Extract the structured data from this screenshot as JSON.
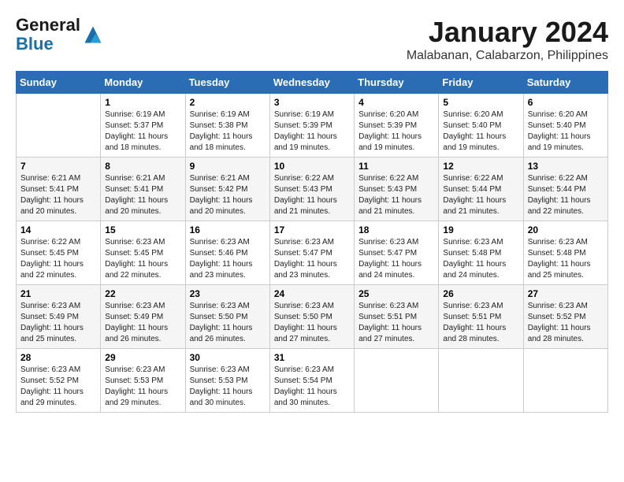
{
  "logo": {
    "general": "General",
    "blue": "Blue"
  },
  "title": "January 2024",
  "subtitle": "Malabanan, Calabarzon, Philippines",
  "days_header": [
    "Sunday",
    "Monday",
    "Tuesday",
    "Wednesday",
    "Thursday",
    "Friday",
    "Saturday"
  ],
  "weeks": [
    [
      {
        "day": "",
        "sunrise": "",
        "sunset": "",
        "daylight": ""
      },
      {
        "day": "1",
        "sunrise": "Sunrise: 6:19 AM",
        "sunset": "Sunset: 5:37 PM",
        "daylight": "Daylight: 11 hours and 18 minutes."
      },
      {
        "day": "2",
        "sunrise": "Sunrise: 6:19 AM",
        "sunset": "Sunset: 5:38 PM",
        "daylight": "Daylight: 11 hours and 18 minutes."
      },
      {
        "day": "3",
        "sunrise": "Sunrise: 6:19 AM",
        "sunset": "Sunset: 5:39 PM",
        "daylight": "Daylight: 11 hours and 19 minutes."
      },
      {
        "day": "4",
        "sunrise": "Sunrise: 6:20 AM",
        "sunset": "Sunset: 5:39 PM",
        "daylight": "Daylight: 11 hours and 19 minutes."
      },
      {
        "day": "5",
        "sunrise": "Sunrise: 6:20 AM",
        "sunset": "Sunset: 5:40 PM",
        "daylight": "Daylight: 11 hours and 19 minutes."
      },
      {
        "day": "6",
        "sunrise": "Sunrise: 6:20 AM",
        "sunset": "Sunset: 5:40 PM",
        "daylight": "Daylight: 11 hours and 19 minutes."
      }
    ],
    [
      {
        "day": "7",
        "sunrise": "Sunrise: 6:21 AM",
        "sunset": "Sunset: 5:41 PM",
        "daylight": "Daylight: 11 hours and 20 minutes."
      },
      {
        "day": "8",
        "sunrise": "Sunrise: 6:21 AM",
        "sunset": "Sunset: 5:41 PM",
        "daylight": "Daylight: 11 hours and 20 minutes."
      },
      {
        "day": "9",
        "sunrise": "Sunrise: 6:21 AM",
        "sunset": "Sunset: 5:42 PM",
        "daylight": "Daylight: 11 hours and 20 minutes."
      },
      {
        "day": "10",
        "sunrise": "Sunrise: 6:22 AM",
        "sunset": "Sunset: 5:43 PM",
        "daylight": "Daylight: 11 hours and 21 minutes."
      },
      {
        "day": "11",
        "sunrise": "Sunrise: 6:22 AM",
        "sunset": "Sunset: 5:43 PM",
        "daylight": "Daylight: 11 hours and 21 minutes."
      },
      {
        "day": "12",
        "sunrise": "Sunrise: 6:22 AM",
        "sunset": "Sunset: 5:44 PM",
        "daylight": "Daylight: 11 hours and 21 minutes."
      },
      {
        "day": "13",
        "sunrise": "Sunrise: 6:22 AM",
        "sunset": "Sunset: 5:44 PM",
        "daylight": "Daylight: 11 hours and 22 minutes."
      }
    ],
    [
      {
        "day": "14",
        "sunrise": "Sunrise: 6:22 AM",
        "sunset": "Sunset: 5:45 PM",
        "daylight": "Daylight: 11 hours and 22 minutes."
      },
      {
        "day": "15",
        "sunrise": "Sunrise: 6:23 AM",
        "sunset": "Sunset: 5:45 PM",
        "daylight": "Daylight: 11 hours and 22 minutes."
      },
      {
        "day": "16",
        "sunrise": "Sunrise: 6:23 AM",
        "sunset": "Sunset: 5:46 PM",
        "daylight": "Daylight: 11 hours and 23 minutes."
      },
      {
        "day": "17",
        "sunrise": "Sunrise: 6:23 AM",
        "sunset": "Sunset: 5:47 PM",
        "daylight": "Daylight: 11 hours and 23 minutes."
      },
      {
        "day": "18",
        "sunrise": "Sunrise: 6:23 AM",
        "sunset": "Sunset: 5:47 PM",
        "daylight": "Daylight: 11 hours and 24 minutes."
      },
      {
        "day": "19",
        "sunrise": "Sunrise: 6:23 AM",
        "sunset": "Sunset: 5:48 PM",
        "daylight": "Daylight: 11 hours and 24 minutes."
      },
      {
        "day": "20",
        "sunrise": "Sunrise: 6:23 AM",
        "sunset": "Sunset: 5:48 PM",
        "daylight": "Daylight: 11 hours and 25 minutes."
      }
    ],
    [
      {
        "day": "21",
        "sunrise": "Sunrise: 6:23 AM",
        "sunset": "Sunset: 5:49 PM",
        "daylight": "Daylight: 11 hours and 25 minutes."
      },
      {
        "day": "22",
        "sunrise": "Sunrise: 6:23 AM",
        "sunset": "Sunset: 5:49 PM",
        "daylight": "Daylight: 11 hours and 26 minutes."
      },
      {
        "day": "23",
        "sunrise": "Sunrise: 6:23 AM",
        "sunset": "Sunset: 5:50 PM",
        "daylight": "Daylight: 11 hours and 26 minutes."
      },
      {
        "day": "24",
        "sunrise": "Sunrise: 6:23 AM",
        "sunset": "Sunset: 5:50 PM",
        "daylight": "Daylight: 11 hours and 27 minutes."
      },
      {
        "day": "25",
        "sunrise": "Sunrise: 6:23 AM",
        "sunset": "Sunset: 5:51 PM",
        "daylight": "Daylight: 11 hours and 27 minutes."
      },
      {
        "day": "26",
        "sunrise": "Sunrise: 6:23 AM",
        "sunset": "Sunset: 5:51 PM",
        "daylight": "Daylight: 11 hours and 28 minutes."
      },
      {
        "day": "27",
        "sunrise": "Sunrise: 6:23 AM",
        "sunset": "Sunset: 5:52 PM",
        "daylight": "Daylight: 11 hours and 28 minutes."
      }
    ],
    [
      {
        "day": "28",
        "sunrise": "Sunrise: 6:23 AM",
        "sunset": "Sunset: 5:52 PM",
        "daylight": "Daylight: 11 hours and 29 minutes."
      },
      {
        "day": "29",
        "sunrise": "Sunrise: 6:23 AM",
        "sunset": "Sunset: 5:53 PM",
        "daylight": "Daylight: 11 hours and 29 minutes."
      },
      {
        "day": "30",
        "sunrise": "Sunrise: 6:23 AM",
        "sunset": "Sunset: 5:53 PM",
        "daylight": "Daylight: 11 hours and 30 minutes."
      },
      {
        "day": "31",
        "sunrise": "Sunrise: 6:23 AM",
        "sunset": "Sunset: 5:54 PM",
        "daylight": "Daylight: 11 hours and 30 minutes."
      },
      {
        "day": "",
        "sunrise": "",
        "sunset": "",
        "daylight": ""
      },
      {
        "day": "",
        "sunrise": "",
        "sunset": "",
        "daylight": ""
      },
      {
        "day": "",
        "sunrise": "",
        "sunset": "",
        "daylight": ""
      }
    ]
  ]
}
